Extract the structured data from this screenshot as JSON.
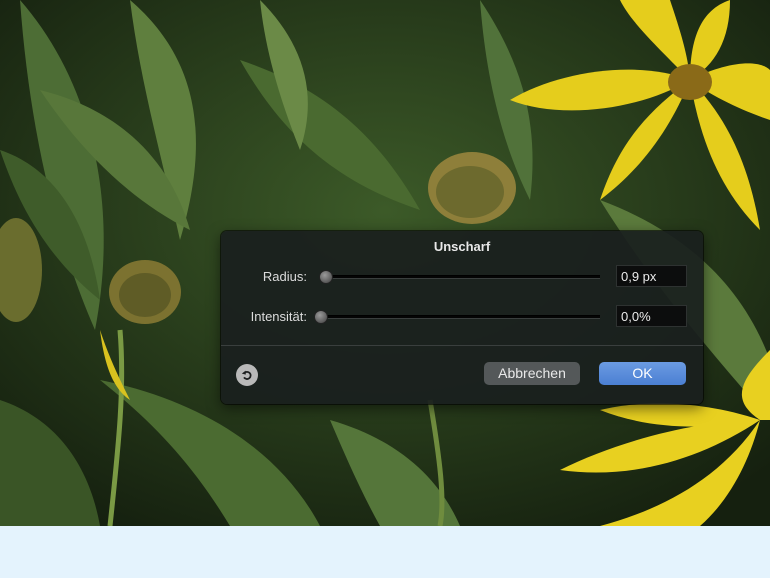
{
  "dialog": {
    "title": "Unscharf",
    "radius": {
      "label": "Radius:",
      "value": "0,9 px",
      "level": 0.0
    },
    "intensity": {
      "label": "Intensität:",
      "value": "0,0%",
      "level": 0.0
    },
    "cancel_label": "Abbrechen",
    "ok_label": "OK"
  },
  "icons": {
    "reset": "reset-icon"
  },
  "colors": {
    "accent": "#5a8ddc",
    "dialog_bg": "#1a1f1e",
    "page_bg": "#e4f3fd"
  }
}
